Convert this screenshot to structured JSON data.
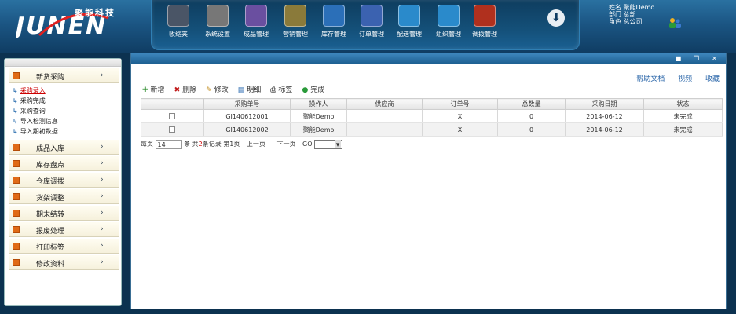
{
  "header": {
    "company": "聚能科技",
    "user_lines": [
      "姓名 聚能Demo",
      "部门 总部",
      "角色 总公司"
    ]
  },
  "toolbar": {
    "items": [
      {
        "label": "收缩夹",
        "icon": "book-icon",
        "color": "#4a5566"
      },
      {
        "label": "系统设置",
        "icon": "gear-icon",
        "color": "#777777"
      },
      {
        "label": "成品管理",
        "icon": "product-icon",
        "color": "#6a4fa0"
      },
      {
        "label": "营销管理",
        "icon": "safe-icon",
        "color": "#8a7a3a"
      },
      {
        "label": "库存管理",
        "icon": "chart-icon",
        "color": "#2b6fb8"
      },
      {
        "label": "订单管理",
        "icon": "facebook-icon",
        "color": "#3b62b0"
      },
      {
        "label": "配送管理",
        "icon": "truck-icon",
        "color": "#2a8acb"
      },
      {
        "label": "组织管理",
        "icon": "org-chart-icon",
        "color": "#2a8acb"
      },
      {
        "label": "调拨管理",
        "icon": "box-icon",
        "color": "#b0301e"
      }
    ]
  },
  "sidebar": {
    "groups": [
      {
        "label": "新货采购",
        "sub": [
          {
            "label": "采购录入",
            "active": true
          },
          {
            "label": "采购完成",
            "active": false
          },
          {
            "label": "采购查询",
            "active": false
          },
          {
            "label": "导入检测信息",
            "active": false
          },
          {
            "label": "导入期初数据",
            "active": false
          }
        ]
      },
      {
        "label": "成品入库",
        "sub": []
      },
      {
        "label": "库存盘点",
        "sub": []
      },
      {
        "label": "仓库调拨",
        "sub": []
      },
      {
        "label": "货架调整",
        "sub": []
      },
      {
        "label": "期末结转",
        "sub": []
      },
      {
        "label": "报废处理",
        "sub": []
      },
      {
        "label": "打印标签",
        "sub": []
      },
      {
        "label": "修改资料",
        "sub": []
      }
    ]
  },
  "main": {
    "top_links": [
      "帮助文档",
      "视频",
      "收藏"
    ],
    "actions": [
      {
        "label": "新增",
        "icon": "plus-icon",
        "glyph": "✚",
        "color": "#2a8a2a"
      },
      {
        "label": "删除",
        "icon": "delete-icon",
        "glyph": "✖",
        "color": "#c01818"
      },
      {
        "label": "修改",
        "icon": "edit-icon",
        "glyph": "✎",
        "color": "#c08a18"
      },
      {
        "label": "明细",
        "icon": "detail-icon",
        "glyph": "▤",
        "color": "#2a6ab0"
      },
      {
        "label": "标签",
        "icon": "print-icon",
        "glyph": "⎙",
        "color": "#555555"
      },
      {
        "label": "完成",
        "icon": "check-icon",
        "glyph": "●",
        "color": "#2a9a3a"
      }
    ],
    "table": {
      "headers": [
        "",
        "采购单号",
        "操作人",
        "供应商",
        "订单号",
        "总数量",
        "采购日期",
        "状态"
      ],
      "rows": [
        [
          "",
          "GI140612001",
          "聚能Demo",
          "",
          "X",
          "0",
          "2014-06-12",
          "未完成"
        ],
        [
          "",
          "GI140612002",
          "聚能Demo",
          "",
          "X",
          "0",
          "2014-06-12",
          "未完成"
        ]
      ]
    },
    "pager": {
      "per_page_label": "每页",
      "per_page_value": "14",
      "unit": "条",
      "total_prefix": "共",
      "total_count": "2",
      "total_suffix": "条记录",
      "page_label": "第1页",
      "prev": "上一页",
      "next": "下一页",
      "go": "GO"
    }
  }
}
